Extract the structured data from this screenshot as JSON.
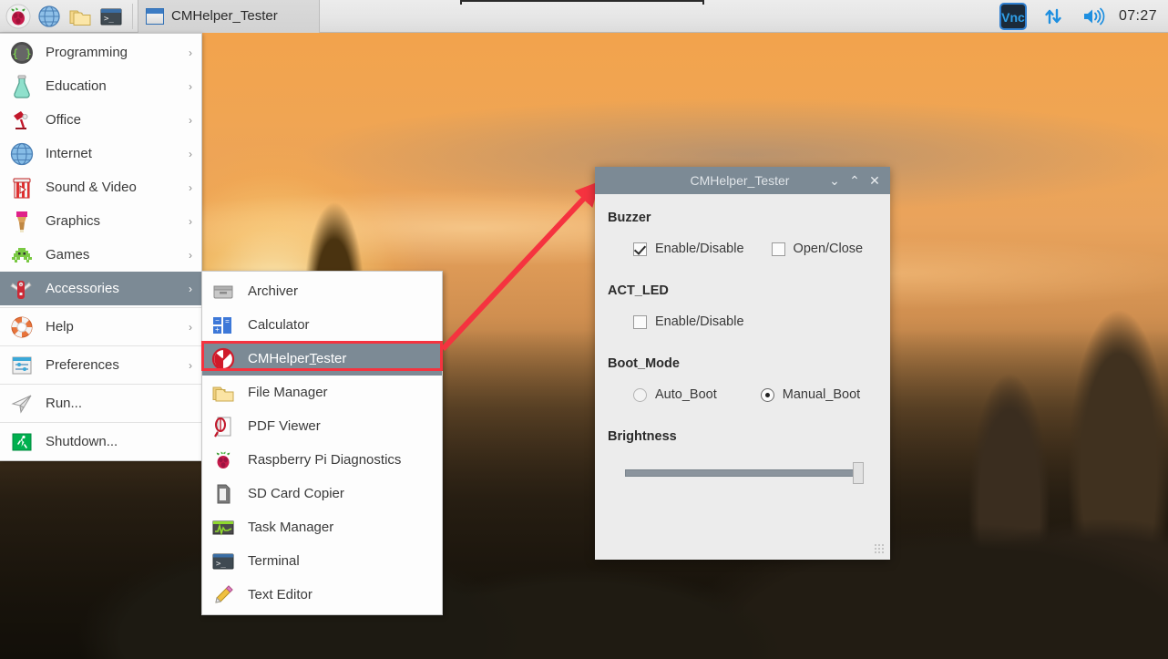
{
  "taskbar": {
    "launchers": [
      {
        "name": "raspberry-menu-icon",
        "label": "Menu"
      },
      {
        "name": "web-browser-icon",
        "label": "Web Browser"
      },
      {
        "name": "file-manager-icon",
        "label": "File Manager"
      },
      {
        "name": "terminal-icon",
        "label": "Terminal"
      }
    ],
    "window_button": {
      "label": "CMHelper_Tester"
    },
    "tray": [
      {
        "name": "vnc-icon",
        "label": "VNC"
      },
      {
        "name": "network-icon",
        "label": "Network"
      },
      {
        "name": "volume-icon",
        "label": "Volume"
      }
    ],
    "clock": "07:27"
  },
  "main_menu": {
    "items": [
      {
        "label": "Programming",
        "icon": "programming-icon",
        "arrow": "›",
        "selected": false
      },
      {
        "label": "Education",
        "icon": "education-icon",
        "arrow": "›",
        "selected": false
      },
      {
        "label": "Office",
        "icon": "office-icon",
        "arrow": "›",
        "selected": false
      },
      {
        "label": "Internet",
        "icon": "internet-icon",
        "arrow": "›",
        "selected": false
      },
      {
        "label": "Sound & Video",
        "icon": "sound-video-icon",
        "arrow": "›",
        "selected": false
      },
      {
        "label": "Graphics",
        "icon": "graphics-icon",
        "arrow": "›",
        "selected": false
      },
      {
        "label": "Games",
        "icon": "games-icon",
        "arrow": "›",
        "selected": false
      },
      {
        "label": "Accessories",
        "icon": "accessories-icon",
        "arrow": "›",
        "selected": true
      },
      {
        "label": "Help",
        "icon": "help-icon",
        "arrow": "›",
        "selected": false
      },
      {
        "label": "Preferences",
        "icon": "preferences-icon",
        "arrow": "›",
        "selected": false
      },
      {
        "label": "Run...",
        "icon": "run-icon",
        "arrow": "",
        "selected": false
      },
      {
        "label": "Shutdown...",
        "icon": "shutdown-icon",
        "arrow": "",
        "selected": false
      }
    ]
  },
  "submenu": {
    "items": [
      {
        "label": "Archiver",
        "icon": "archiver-icon",
        "selected": false
      },
      {
        "label": "Calculator",
        "icon": "calculator-icon",
        "selected": false
      },
      {
        "label": "CMHelperTester",
        "icon": "cmhelper-icon",
        "selected": true,
        "mnemonic_index": 8
      },
      {
        "label": "File Manager",
        "icon": "file-manager-icon",
        "selected": false
      },
      {
        "label": "PDF Viewer",
        "icon": "pdf-viewer-icon",
        "selected": false
      },
      {
        "label": "Raspberry Pi Diagnostics",
        "icon": "raspberry-icon",
        "selected": false
      },
      {
        "label": "SD Card Copier",
        "icon": "sd-card-icon",
        "selected": false
      },
      {
        "label": "Task Manager",
        "icon": "task-manager-icon",
        "selected": false
      },
      {
        "label": "Terminal",
        "icon": "terminal-icon",
        "selected": false
      },
      {
        "label": "Text Editor",
        "icon": "text-editor-icon",
        "selected": false
      }
    ]
  },
  "dialog": {
    "title": "CMHelper_Tester",
    "window_buttons": {
      "minimize": "⌄",
      "maximize": "⌃",
      "close": "✕"
    },
    "groups": [
      {
        "title": "Buzzer",
        "type": "checkbox",
        "controls": [
          {
            "label": "Enable/Disable",
            "checked": true
          },
          {
            "label": "Open/Close",
            "checked": false
          }
        ]
      },
      {
        "title": "ACT_LED",
        "type": "checkbox",
        "controls": [
          {
            "label": "Enable/Disable",
            "checked": false
          }
        ]
      },
      {
        "title": "Boot_Mode",
        "type": "radio",
        "controls": [
          {
            "label": "Auto_Boot",
            "checked": false
          },
          {
            "label": "Manual_Boot",
            "checked": true
          }
        ]
      }
    ],
    "brightness": {
      "title": "Brightness",
      "value": 100,
      "min": 0,
      "max": 100
    }
  },
  "annotation": {
    "color": "#f5333f",
    "target": "CMHelperTester"
  }
}
